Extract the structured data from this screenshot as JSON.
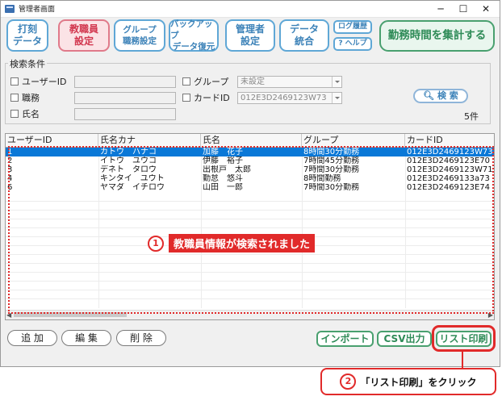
{
  "window": {
    "title": "管理者画面",
    "controls": {
      "minimize": "─",
      "maximize": "☐",
      "close": "✕"
    }
  },
  "nav": [
    {
      "line1": "打刻",
      "line2": "データ"
    },
    {
      "line1": "教職員",
      "line2": "設定"
    },
    {
      "line1": "グループ",
      "line2": "職務設定"
    },
    {
      "line1": "バックアップ",
      "line2": "データ復元"
    },
    {
      "line1": "管理者",
      "line2": "設定"
    },
    {
      "line1": "データ",
      "line2": "統合"
    }
  ],
  "log_history_label": "ログ履歴",
  "help_label": "? ヘルプ",
  "aggregate_label": "勤務時間を集計する",
  "search": {
    "legend": "検索条件",
    "user_id_label": "ユーザーID",
    "duty_label": "職務",
    "name_label": "氏名",
    "group_label": "グループ",
    "group_value": "未設定",
    "card_label": "カードID",
    "card_value": "012E3D2469123W73",
    "search_button": "検 索",
    "count": "5件"
  },
  "table": {
    "headers": [
      "ユーザーID",
      "氏名カナ",
      "氏名",
      "グループ",
      "カードID"
    ],
    "rows": [
      [
        "1",
        "カトウ　ハナコ",
        "加藤　花子",
        "8時間30分勤務",
        "012E3D2469123W73"
      ],
      [
        "2",
        "イトウ　ユウコ",
        "伊藤　裕子",
        "7時間45分勤務",
        "012E3D2469123E70"
      ],
      [
        "3",
        "デネト　タロウ",
        "出根戸　太郎",
        "7時間30分勤務",
        "012E3D2469123W71"
      ],
      [
        "4",
        "キンタイ　ユウト",
        "勤怠　悠斗",
        "8時間勤務",
        "012E3D2469133a73"
      ],
      [
        "6",
        "ヤマダ　イチロウ",
        "山田　一郎",
        "7時間30分勤務",
        "012E3D2469123E74"
      ]
    ]
  },
  "bottom": {
    "add": "追 加",
    "edit": "編 集",
    "delete": "削 除",
    "import": "インポート",
    "csv": "CSV出力",
    "print": "リスト印刷"
  },
  "annotations": {
    "step1_num": "1",
    "step1_text": "教職員情報が検索されました",
    "step2_num": "2",
    "step2_text": "「リスト印刷」をクリック"
  },
  "colors": {
    "accent_red": "#e12a2a",
    "selection": "#0a78d7",
    "nav_blue": "#3c82b8",
    "green": "#2e8b57"
  }
}
